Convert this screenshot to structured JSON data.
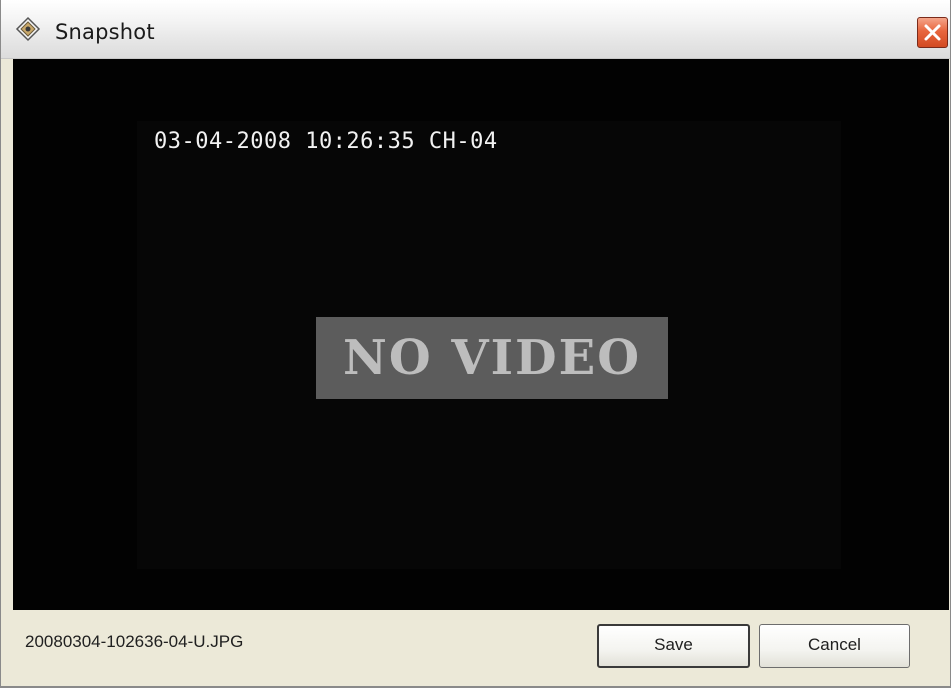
{
  "window": {
    "title": "Snapshot",
    "app_icon": "snapshot-app-icon",
    "close_icon": "close-icon"
  },
  "video": {
    "osd": "03-04-2008 10:26:35 CH-04",
    "status": "NO VIDEO"
  },
  "footer": {
    "filename": "20080304-102636-04-U.JPG",
    "save_label": "Save",
    "cancel_label": "Cancel"
  },
  "colors": {
    "close_button": "#d24a22",
    "video_background": "#020202",
    "no_video_box": "#5c5c5c"
  }
}
